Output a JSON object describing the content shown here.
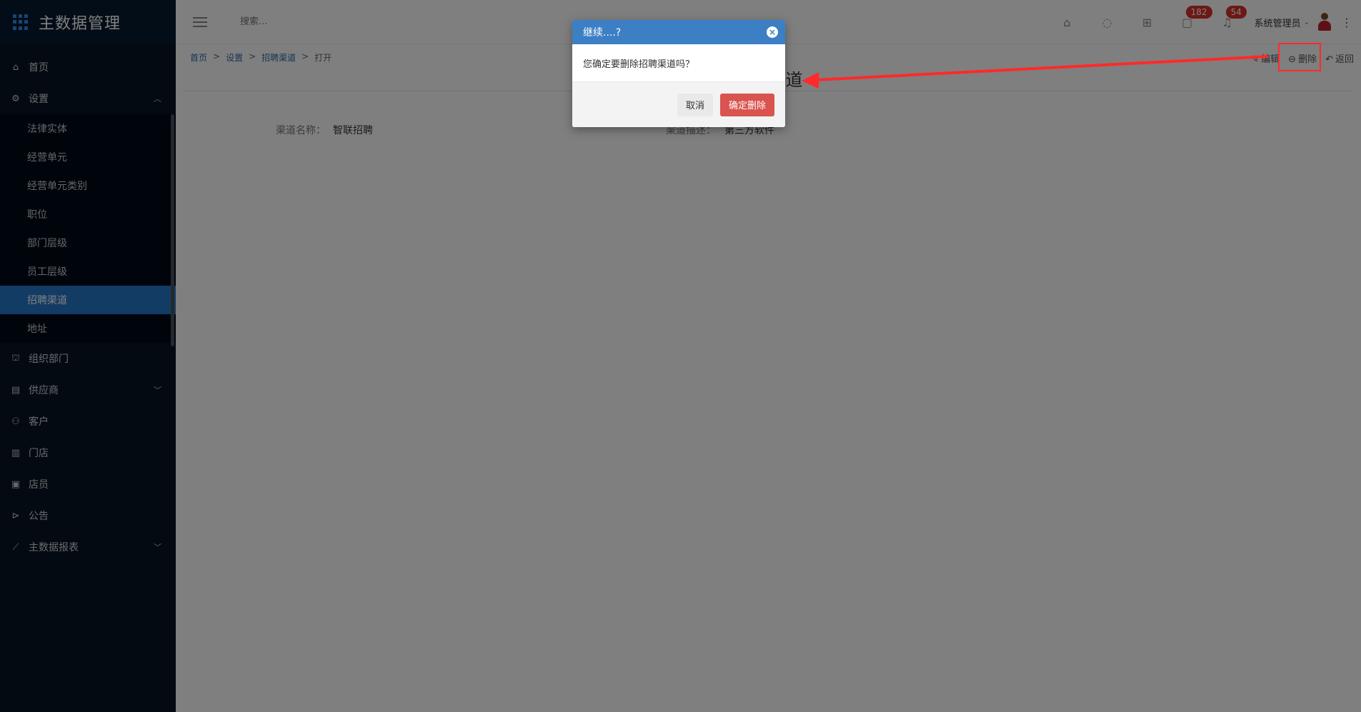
{
  "app": {
    "title": "主数据管理"
  },
  "sidebar": {
    "items": [
      {
        "label": "首页",
        "icon": "home-icon"
      },
      {
        "label": "设置",
        "icon": "gear-icon",
        "expanded": true,
        "children": [
          {
            "label": "法律实体"
          },
          {
            "label": "经营单元"
          },
          {
            "label": "经营单元类别"
          },
          {
            "label": "职位"
          },
          {
            "label": "部门层级"
          },
          {
            "label": "员工层级"
          },
          {
            "label": "招聘渠道",
            "active": true
          },
          {
            "label": "地址"
          }
        ]
      },
      {
        "label": "组织部门",
        "icon": "org-chart-icon"
      },
      {
        "label": "供应商",
        "icon": "supplier-icon",
        "has_children": true
      },
      {
        "label": "客户",
        "icon": "customer-icon"
      },
      {
        "label": "门店",
        "icon": "store-icon"
      },
      {
        "label": "店员",
        "icon": "clerk-icon"
      },
      {
        "label": "公告",
        "icon": "announcement-icon"
      },
      {
        "label": "主数据报表",
        "icon": "report-chart-icon",
        "has_children": true
      }
    ]
  },
  "header": {
    "search_placeholder": "搜索...",
    "badges": {
      "messages": "182",
      "notifications": "54"
    },
    "user_name": "系统管理员"
  },
  "content": {
    "breadcrumb": [
      "首页",
      "设置",
      "招聘渠道",
      "打开"
    ],
    "page_title": "招聘渠道",
    "actions": {
      "edit": "编辑",
      "delete": "删除",
      "back": "返回"
    },
    "fields": {
      "channel_name_label": "渠道名称：",
      "channel_name_value": "智联招聘",
      "channel_desc_label": "渠道描述：",
      "channel_desc_value": "第三方软件"
    }
  },
  "dialog": {
    "title": "继续....?",
    "message": "您确定要删除招聘渠道吗？",
    "cancel_label": "取消",
    "confirm_label": "确定删除"
  },
  "colors": {
    "primary": "#2778c9",
    "danger": "#d9534f",
    "sidebar_bg": "#061423",
    "annotation": "#ff2a2a"
  }
}
